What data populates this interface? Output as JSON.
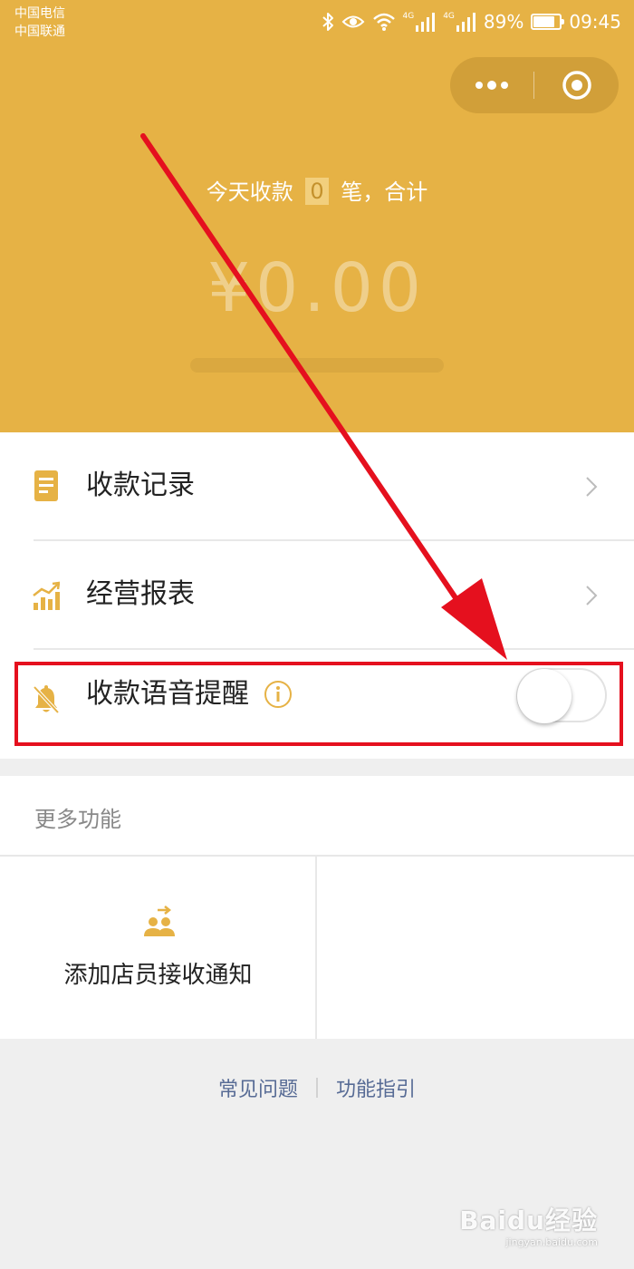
{
  "status_bar": {
    "carrier_1": "中国电信",
    "carrier_2": "中国联通",
    "network_1": "4G",
    "network_2": "4G",
    "battery": "89%",
    "battery_level": 0.89,
    "time": "09:45"
  },
  "header": {
    "summary_prefix": "今天收款",
    "count": "0",
    "summary_suffix": "笔，合计",
    "amount": "¥0.00",
    "background_color": "#e6b245"
  },
  "menu": {
    "records_label": "收款记录",
    "reports_label": "经营报表",
    "voice_label": "收款语音提醒",
    "voice_enabled": false
  },
  "more": {
    "title": "更多功能",
    "add_staff_label": "添加店员接收通知"
  },
  "footer": {
    "faq": "常见问题",
    "guide": "功能指引"
  },
  "watermark": {
    "main": "Baidu经验",
    "sub": "jingyan.baidu.com"
  },
  "icons": {
    "records": "document-icon",
    "reports": "bar-chart-icon",
    "voice": "bell-mute-icon",
    "info": "info-icon",
    "add_staff": "add-staff-icon",
    "chevron": "chevron-right-icon",
    "more": "more-dots-icon",
    "close": "target-close-icon"
  },
  "colors": {
    "accent": "#e6b245",
    "annotation": "#e5101e",
    "link": "#576b95"
  }
}
